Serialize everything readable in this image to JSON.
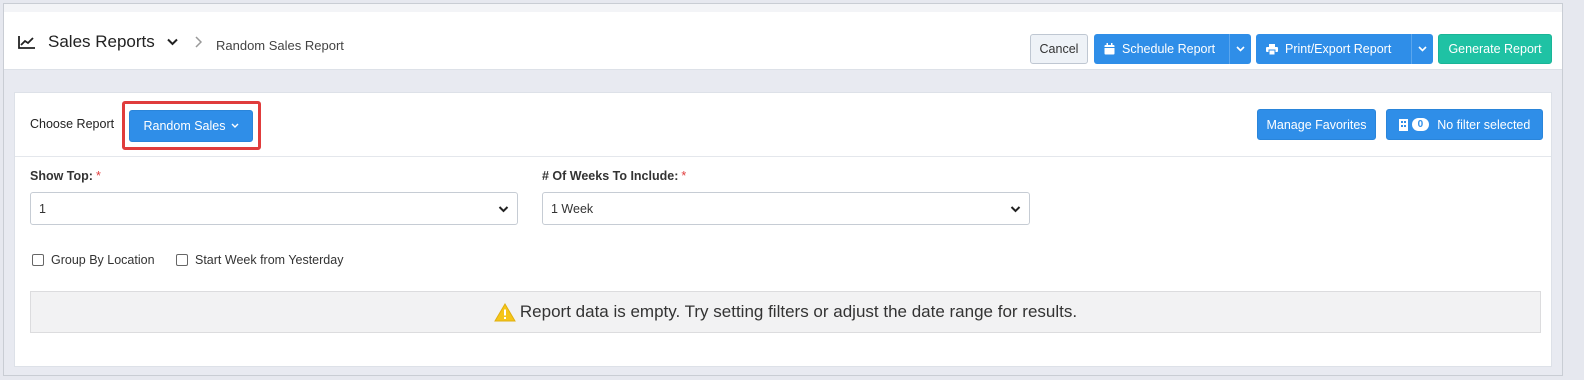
{
  "header": {
    "title": "Sales Reports",
    "breadcrumb_sep": ">",
    "breadcrumb": "Random Sales Report"
  },
  "toolbar": {
    "cancel_label": "Cancel",
    "schedule_label": "Schedule Report",
    "print_label": "Print/Export Report",
    "generate_label": "Generate Report"
  },
  "report": {
    "choose_label": "Choose Report",
    "selected_report": "Random Sales",
    "manage_favorites_label": "Manage Favorites",
    "filter_count": "0",
    "filter_label": "No filter selected"
  },
  "fields": {
    "show_top_label": "Show Top:",
    "show_top_value": "1",
    "weeks_label": "# Of Weeks To Include:",
    "weeks_value": "1 Week",
    "required_mark": "*"
  },
  "options": {
    "group_by_location": "Group By Location",
    "start_week_yesterday": "Start Week from Yesterday"
  },
  "message": {
    "empty_text": "Report data is empty. Try setting filters or adjust the date range for results."
  },
  "colors": {
    "primary": "#2f8ee8",
    "success": "#1fc2a4",
    "highlight": "#e03c3c",
    "warning": "#f5c518"
  }
}
